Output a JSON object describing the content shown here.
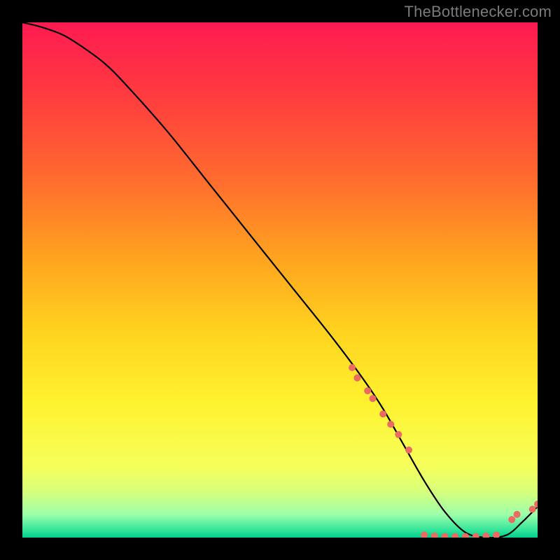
{
  "watermark": "TheBottlenecker.com",
  "chart_data": {
    "type": "line",
    "title": "",
    "xlabel": "",
    "ylabel": "",
    "xlim": [
      0,
      100
    ],
    "ylim": [
      0,
      100
    ],
    "series": [
      {
        "name": "curve",
        "x": [
          0,
          4,
          8,
          12,
          16,
          20,
          28,
          36,
          44,
          52,
          60,
          66,
          70,
          74,
          78,
          82,
          86,
          90,
          94,
          97,
          100
        ],
        "y": [
          100,
          99,
          97.5,
          95,
          92,
          88,
          79,
          69,
          59,
          49,
          39,
          31,
          25,
          18,
          11,
          5,
          1,
          0,
          0.5,
          3,
          6
        ]
      }
    ],
    "markers": [
      {
        "x": 64,
        "y": 33
      },
      {
        "x": 65,
        "y": 31
      },
      {
        "x": 67,
        "y": 28.5
      },
      {
        "x": 68,
        "y": 27
      },
      {
        "x": 70,
        "y": 24
      },
      {
        "x": 71.5,
        "y": 22
      },
      {
        "x": 73,
        "y": 20
      },
      {
        "x": 75,
        "y": 17
      },
      {
        "x": 78,
        "y": 0.5
      },
      {
        "x": 80,
        "y": 0.3
      },
      {
        "x": 82,
        "y": 0.2
      },
      {
        "x": 84,
        "y": 0.2
      },
      {
        "x": 86,
        "y": 0.2
      },
      {
        "x": 88,
        "y": 0.2
      },
      {
        "x": 90,
        "y": 0.3
      },
      {
        "x": 92,
        "y": 0.5
      },
      {
        "x": 95,
        "y": 3.5
      },
      {
        "x": 96,
        "y": 4.5
      },
      {
        "x": 99,
        "y": 5.5
      },
      {
        "x": 100,
        "y": 6.5
      }
    ],
    "gradient_stops": [
      {
        "offset": 0.0,
        "color": "#ff1a52"
      },
      {
        "offset": 0.14,
        "color": "#ff3b3f"
      },
      {
        "offset": 0.3,
        "color": "#ff6a2f"
      },
      {
        "offset": 0.46,
        "color": "#ffa41f"
      },
      {
        "offset": 0.6,
        "color": "#ffd31f"
      },
      {
        "offset": 0.74,
        "color": "#fff22f"
      },
      {
        "offset": 0.86,
        "color": "#f6ff5a"
      },
      {
        "offset": 0.91,
        "color": "#d8ff7a"
      },
      {
        "offset": 0.955,
        "color": "#9dffab"
      },
      {
        "offset": 0.985,
        "color": "#35e59a"
      },
      {
        "offset": 1.0,
        "color": "#00cf8d"
      }
    ]
  }
}
